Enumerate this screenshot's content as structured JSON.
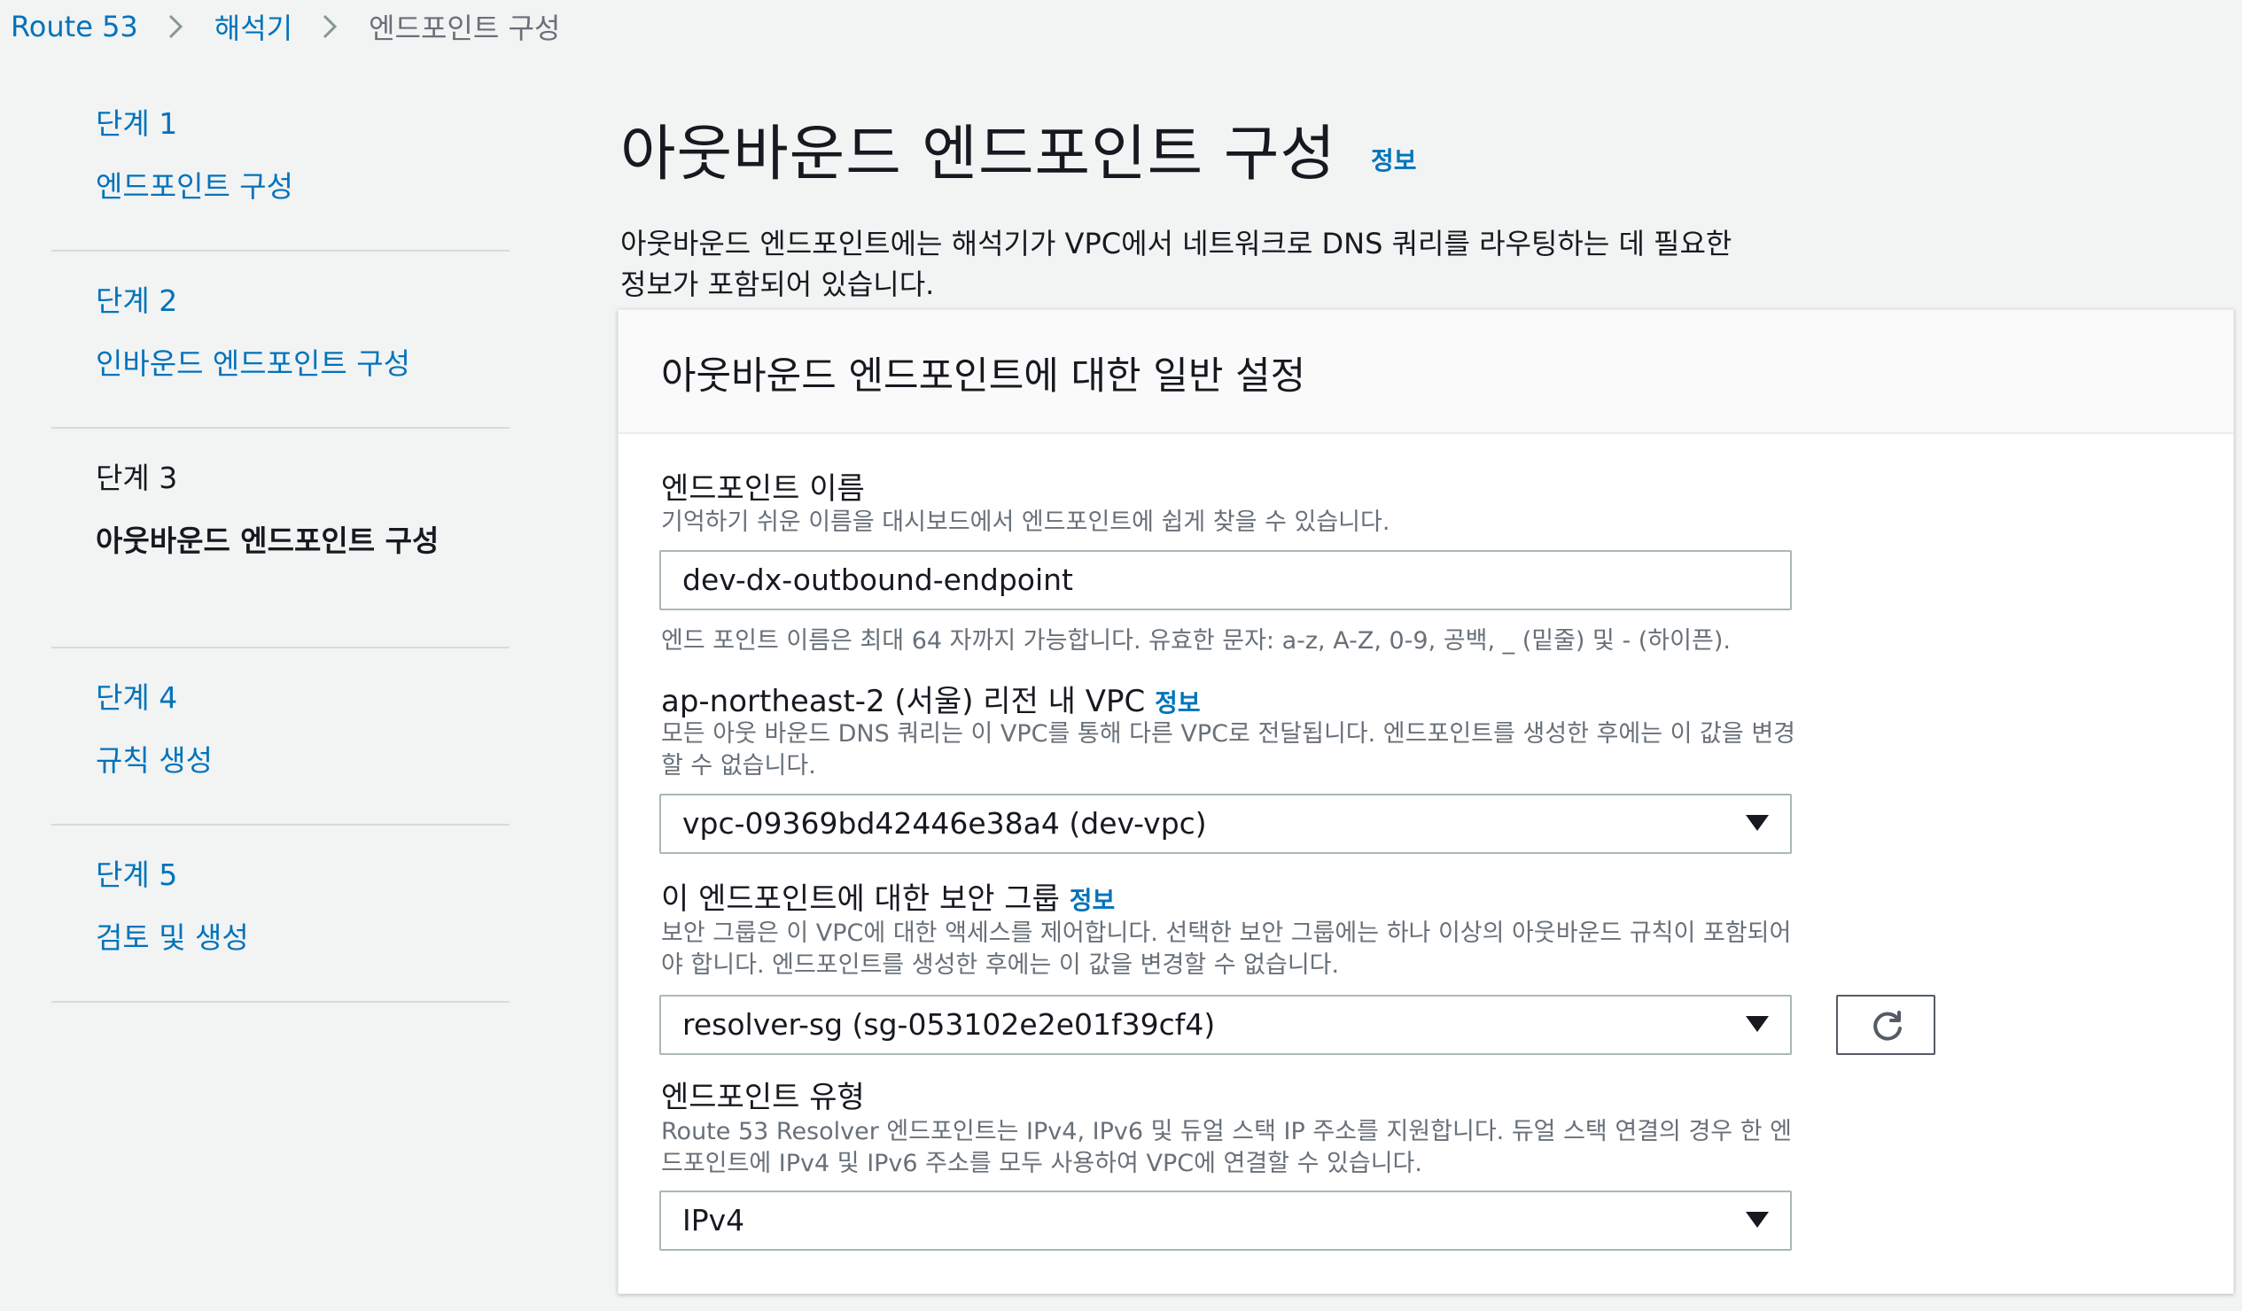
{
  "breadcrumb": {
    "items": [
      "Route 53",
      "해석기",
      "엔드포인트 구성"
    ]
  },
  "sidebar": {
    "steps": [
      {
        "num": "단계 1",
        "title": "엔드포인트 구성"
      },
      {
        "num": "단계 2",
        "title": "인바운드 엔드포인트 구성"
      },
      {
        "num": "단계 3",
        "title": "아웃바운드 엔드포인트 구성"
      },
      {
        "num": "단계 4",
        "title": "규칙 생성"
      },
      {
        "num": "단계 5",
        "title": "검토 및 생성"
      }
    ]
  },
  "header": {
    "title": "아웃바운드 엔드포인트 구성",
    "info": "정보",
    "intro": "아웃바운드 엔드포인트에는 해석기가 VPC에서 네트워크로 DNS 쿼리를 라우팅하는 데 필요한 정보가 포함되어 있습니다."
  },
  "panel": {
    "title": "아웃바운드 엔드포인트에 대한 일반 설정",
    "name_field": {
      "label": "엔드포인트 이름",
      "description": "기억하기 쉬운 이름을 대시보드에서 엔드포인트에 쉽게 찾을 수 있습니다.",
      "value": "dev-dx-outbound-endpoint",
      "constraint": "엔드 포인트 이름은 최대 64 자까지 가능합니다. 유효한 문자: a-z, A-Z, 0-9, 공백, _ (밑줄) 및 - (하이픈)."
    },
    "vpc_field": {
      "label": "ap-northeast-2 (서울) 리전 내 VPC",
      "info": "정보",
      "description": "모든 아웃 바운드 DNS 쿼리는 이 VPC를 통해 다른 VPC로 전달됩니다. 엔드포인트를 생성한 후에는 이 값을 변경할 수 없습니다.",
      "value": "vpc-09369bd42446e38a4 (dev-vpc)"
    },
    "sg_field": {
      "label": "이 엔드포인트에 대한 보안 그룹",
      "info": "정보",
      "description": "보안 그룹은 이 VPC에 대한 액세스를 제어합니다. 선택한 보안 그룹에는 하나 이상의 아웃바운드 규칙이 포함되어야 합니다. 엔드포인트를 생성한 후에는 이 값을 변경할 수 없습니다.",
      "value": "resolver-sg (sg-053102e2e01f39cf4)"
    },
    "type_field": {
      "label": "엔드포인트 유형",
      "description": "Route 53 Resolver 엔드포인트는 IPv4, IPv6 및 듀얼 스택 IP 주소를 지원합니다. 듀얼 스택 연결의 경우 한 엔드포인트에 IPv4 및 IPv6 주소를 모두 사용하여 VPC에 연결할 수 있습니다.",
      "value": "IPv4"
    }
  },
  "icons": {
    "breadcrumb_separator": "chevron-right-icon",
    "select_caret": "caret-down-icon",
    "refresh": "refresh-icon"
  },
  "colors": {
    "link": "#0073bb",
    "text": "#16191f",
    "muted": "#687078",
    "background": "#f2f3f3"
  }
}
